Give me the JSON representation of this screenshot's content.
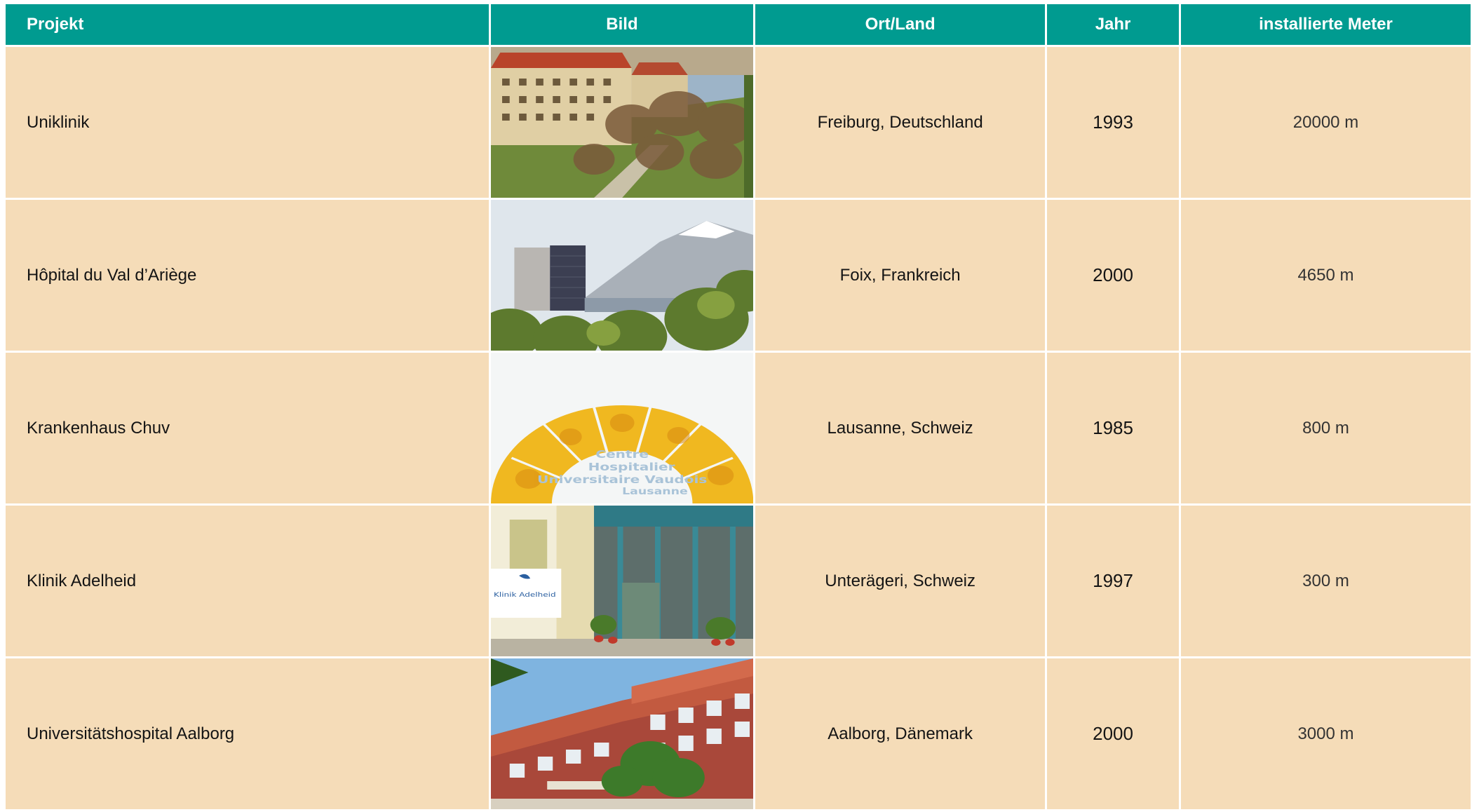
{
  "table": {
    "headers": {
      "projekt": "Projekt",
      "bild": "Bild",
      "ort": "Ort/Land",
      "jahr": "Jahr",
      "meter": "installierte Meter"
    },
    "rows": [
      {
        "projekt": "Uniklinik",
        "ort": "Freiburg, Deutschland",
        "jahr": "1993",
        "meter": "20000 m",
        "image_subject": "hospital-campus-red-roofs-trees"
      },
      {
        "projekt": "Hôpital du Val d’Ariège",
        "ort": "Foix, Frankreich",
        "jahr": "2000",
        "meter": "4650 m",
        "image_subject": "tower-building-mountains"
      },
      {
        "projekt": "Krankenhaus Chuv",
        "ort": "Lausanne, Schweiz",
        "jahr": "1985",
        "meter": "800 m",
        "image_subject": "chuv-logo-yellow-arch",
        "logo_text": [
          "Centre",
          "Hospitalier",
          "Universitaire Vaudois",
          "Lausanne"
        ]
      },
      {
        "projekt": "Klinik Adelheid",
        "ort": "Unterägeri, Schweiz",
        "jahr": "1997",
        "meter": "300 m",
        "image_subject": "clinic-entrance-canopy",
        "sign_text": "Klinik Adelheid"
      },
      {
        "projekt": "Universitätshospital Aalborg",
        "ort": "Aalborg, Dänemark",
        "jahr": "2000",
        "meter": "3000 m",
        "image_subject": "brick-hospital-trees"
      }
    ]
  },
  "colors": {
    "header_bg": "#009b90",
    "cell_bg": "#f5dcb8",
    "header_text": "#ffffff"
  }
}
